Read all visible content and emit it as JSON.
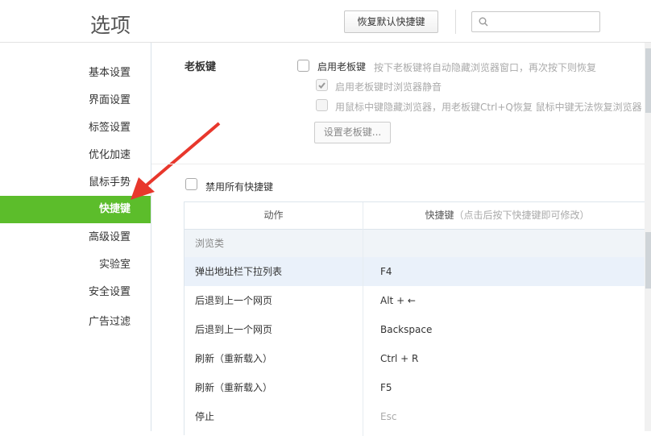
{
  "header": {
    "title": "选项",
    "reset_button": "恢复默认快捷键",
    "search_placeholder": ""
  },
  "sidebar": {
    "items": [
      {
        "label": "基本设置"
      },
      {
        "label": "界面设置"
      },
      {
        "label": "标签设置"
      },
      {
        "label": "优化加速"
      },
      {
        "label": "鼠标手势"
      },
      {
        "label": "快捷键",
        "active": true
      },
      {
        "label": "高级设置"
      },
      {
        "label": "实验室"
      },
      {
        "label": "安全设置"
      },
      {
        "label": "广告过滤"
      }
    ]
  },
  "boss_key": {
    "title": "老板键",
    "enable_label": "启用老板键",
    "enable_desc": "按下老板键将自动隐藏浏览器窗口，再次按下则恢复",
    "mute_label": "启用老板键时浏览器静音",
    "middle_label": "用鼠标中键隐藏浏览器，用老板键Ctrl+Q恢复   鼠标中键无法恢复浏览器",
    "set_button": "设置老板键..."
  },
  "disable_all": "禁用所有快捷键",
  "table": {
    "col_action": "动作",
    "col_key": "快捷键",
    "col_key_hint": "（点击后按下快捷键即可修改）",
    "group": "浏览类",
    "rows": [
      {
        "action": "弹出地址栏下拉列表",
        "key": "F4"
      },
      {
        "action": "后退到上一个网页",
        "key": "Alt + ←"
      },
      {
        "action": "后退到上一个网页",
        "key": "Backspace"
      },
      {
        "action": "刷新（重新载入）",
        "key": "Ctrl + R"
      },
      {
        "action": "刷新（重新载入）",
        "key": "F5"
      },
      {
        "action": "停止",
        "key": "Esc"
      }
    ]
  },
  "colors": {
    "accent": "#5cbd2b",
    "arrow": "#e8372c",
    "row_highlight": "#eaf1fa"
  }
}
